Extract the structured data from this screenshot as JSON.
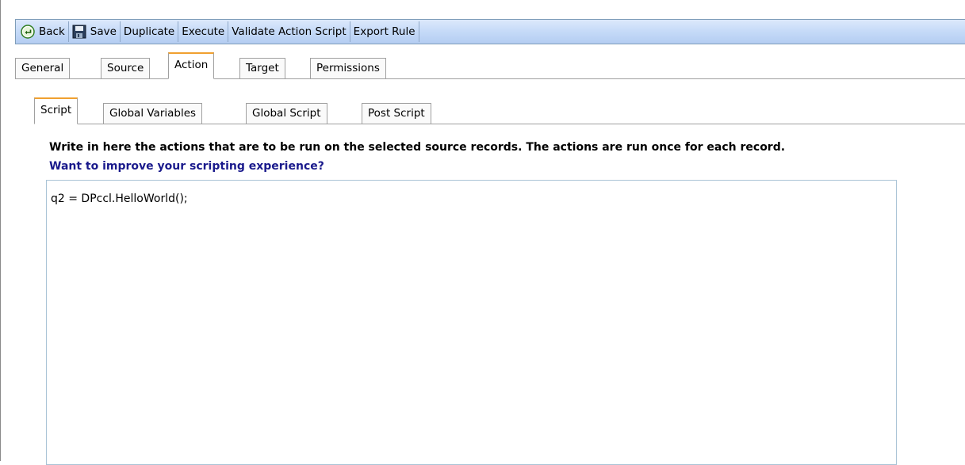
{
  "toolbar": {
    "back": "Back",
    "save": "Save",
    "duplicate": "Duplicate",
    "execute": "Execute",
    "validate": "Validate Action Script",
    "export": "Export Rule"
  },
  "tabs": {
    "general": "General",
    "source": "Source",
    "action": "Action",
    "target": "Target",
    "permissions": "Permissions"
  },
  "subtabs": {
    "script": "Script",
    "global_variables": "Global Variables",
    "global_script": "Global Script",
    "post_script": "Post Script"
  },
  "content": {
    "description": "Write in here the actions that are to be run on the selected source records. The actions are run once for each record.",
    "link": "Want to improve your scripting experience?",
    "script_value": "q2 = DPccl.HelloWorld();"
  },
  "colors": {
    "toolbar_accent": "#c5daf8",
    "active_tab_accent": "#f0a030",
    "link": "#1a1a8c"
  },
  "icons": {
    "back": "back-circle-arrow-icon",
    "save": "floppy-disk-icon"
  }
}
